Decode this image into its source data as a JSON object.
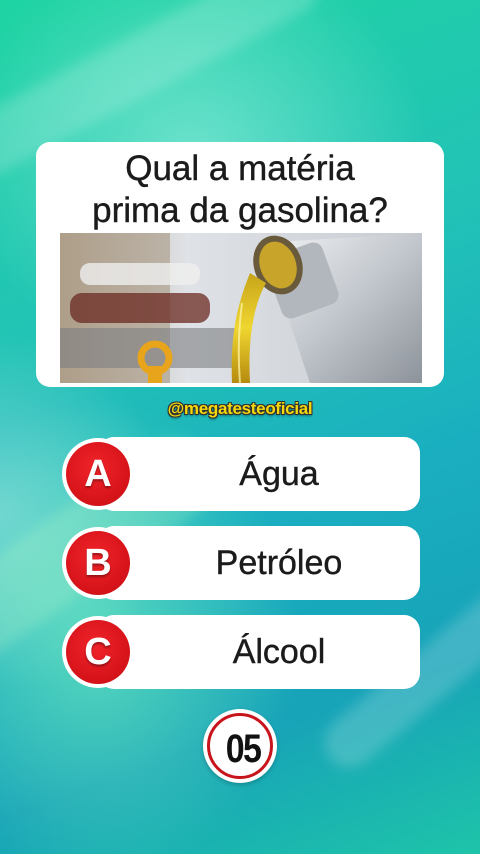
{
  "question": {
    "line1": "Qual a matéria",
    "line2": "prima da gasolina?"
  },
  "image": {
    "icon": "oil-pouring-photo"
  },
  "handle": "@megatesteoficial",
  "options": [
    {
      "letter": "A",
      "text": "Água"
    },
    {
      "letter": "B",
      "text": "Petróleo"
    },
    {
      "letter": "C",
      "text": "Álcool"
    }
  ],
  "timer": "05",
  "colors": {
    "badge": "#d51219",
    "handle": "#f4d80a",
    "background": "#1fbfb5"
  }
}
